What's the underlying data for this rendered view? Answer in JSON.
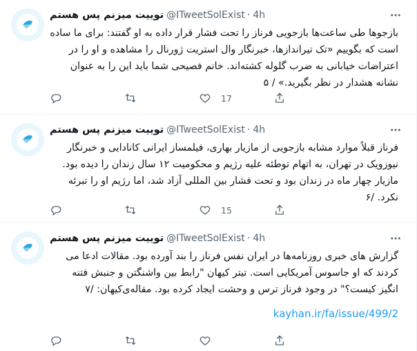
{
  "tweets": [
    {
      "display_name": "توییت میزنم پس هستم",
      "handle": "@ITweetSolExist",
      "separator": "·",
      "time": "4h",
      "avatar_label": "Tweet",
      "text": "بازجوها طی ساعت‌ها بازجویی فرناز را تحت فشار قرار داده به او گفتند: برای ما ساده است که بگوییم «تک تیراندازها، خبرنگار وال استریت ژورنال را مشاهده و او را در اعتراضات خیابانی به ضرب گلوله کشته‌اند. خانم فصیحی شما باید این را به عنوان نشانه هشدار در نظر بگیرید.» / ۵",
      "link": "",
      "reply_count": "",
      "retweet_count": "",
      "like_count": "17"
    },
    {
      "display_name": "توییت میزنم پس هستم",
      "handle": "@ITweetSolExist",
      "separator": "·",
      "time": "4h",
      "avatar_label": "Tweet",
      "text": "فرناز قبلاً موارد مشابه بازجویی از مازیار بهاری، فیلمساز ایرانی کانادایی و خبرنگار نیوزویک در تهران، به اتهام توطئه علیه رژیم و محکومیت ۱۲ سال زندان را دیده بود. مازیار چهار ماه در زندان بود و تحت فشار بین المللی آزاد شد، اما رژیم او را تبرئه نکرد. /۶",
      "link": "",
      "reply_count": "",
      "retweet_count": "",
      "like_count": "15"
    },
    {
      "display_name": "توییت میزنم پس هستم",
      "handle": "@ITweetSolExist",
      "separator": "·",
      "time": "4h",
      "avatar_label": "Tweet",
      "text": "گزارش های خبری روزنامه‌ها در ایران نفس فرناز را بند آورده بود. مقالات ادعا می کردند که او جاسوس آمریکایی است. تیتر کیهان \"رابط بین واشنگتن و جنبش فتنه انگیز کیست؟\" در وجود فرناز ترس و وحشت ایجاد کرده بود. مقاله‌ی‌کیهان: /۷",
      "link": "kayhan.ir/fa/issue/499/2",
      "reply_count": "",
      "retweet_count": "",
      "like_count": ""
    }
  ],
  "colors": {
    "text_primary": "#0f1419",
    "text_secondary": "#536471",
    "link": "#1d9bf0",
    "avatar_bg": "#e8f6fd",
    "avatar_accent": "#2aa9e0",
    "divider": "#eff3f4"
  },
  "icons": [
    "reply-icon",
    "retweet-icon",
    "like-icon",
    "share-icon",
    "more-icon",
    "tweet-bird-avatar"
  ]
}
